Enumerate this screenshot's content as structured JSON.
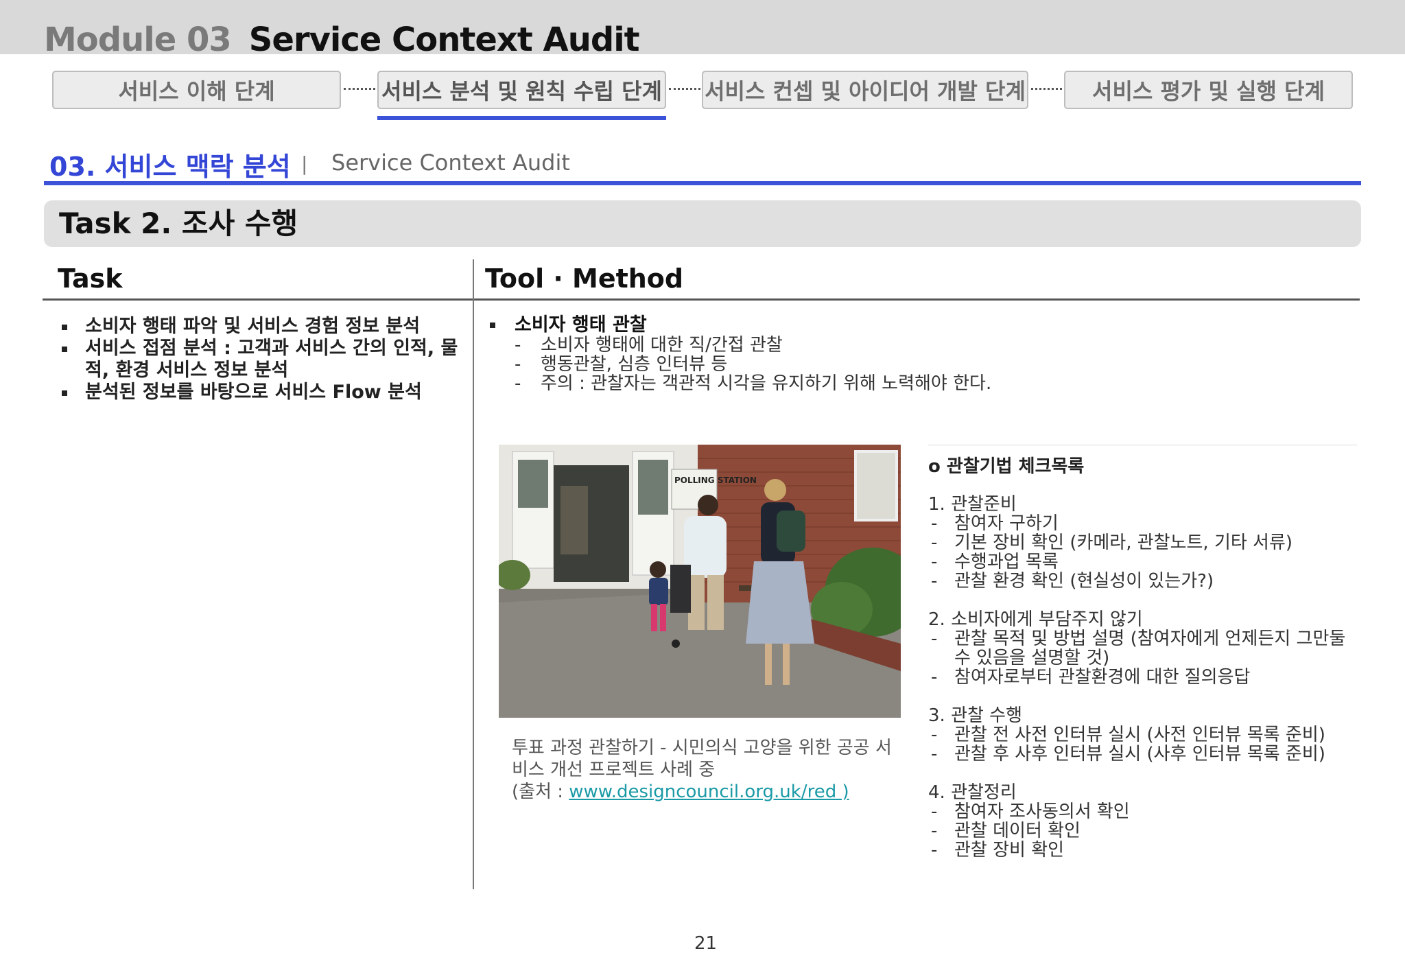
{
  "header": {
    "module_label": "Module 03",
    "module_name": "Service Context Audit"
  },
  "stages": [
    {
      "label": "서비스 이해 단계",
      "active": false
    },
    {
      "label": "서비스 분석 및 원칙 수립 단계",
      "active": true
    },
    {
      "label": "서비스 컨셉 및 아이디어 개발 단계",
      "active": false
    },
    {
      "label": "서비스 평가 및 실행 단계",
      "active": false
    }
  ],
  "section": {
    "title": "03. 서비스 맥락 분석",
    "separator": "|",
    "subtitle": "Service Context Audit"
  },
  "task_banner": "Task 2. 조사 수행",
  "columns": {
    "task": "Task",
    "method": "Tool · Method"
  },
  "tasks": [
    "소비자 행태 파악 및 서비스 경험 정보 분석",
    "서비스 접점 분석 : 고객과 서비스 간의 인적, 물적, 환경 서비스 정보 분석",
    "분석된 정보를 바탕으로 서비스 Flow 분석"
  ],
  "method": {
    "title": "소비자 행태 관찰",
    "items": [
      "소비자 행태에 대한 직/간접 관찰",
      "행동관찰, 심층 인터뷰 등",
      "주의 : 관찰자는 객관적 시각을 유지하기 위해 노력해야 한다."
    ]
  },
  "photo": {
    "sign_text": "POLLING STATION"
  },
  "caption": {
    "text": "투표 과정 관찰하기 - 시민의식 고양을 위한 공공 서비스 개선 프로젝트 사례 중",
    "source_prefix": "(출처 : ",
    "source_link": "www.designcouncil.org.uk/red )"
  },
  "checklist": {
    "title": "o 관찰기법 체크목록",
    "sections": [
      {
        "heading": "1. 관찰준비",
        "items": [
          "참여자 구하기",
          "기본 장비 확인 (카메라, 관찰노트, 기타 서류)",
          "수행과업 목록",
          "관찰 환경 확인 (현실성이 있는가?)"
        ]
      },
      {
        "heading": "2. 소비자에게 부담주지 않기",
        "items": [
          "관찰 목적 및 방법 설명 (참여자에게 언제든지 그만둘 수 있음을 설명할 것)",
          "참여자로부터 관찰환경에 대한 질의응답"
        ]
      },
      {
        "heading": "3. 관찰 수행",
        "items": [
          "관찰 전 사전 인터뷰 실시 (사전 인터뷰 목록 준비)",
          "관찰 후 사후 인터뷰 실시 (사후 인터뷰 목록 준비)"
        ]
      },
      {
        "heading": "4. 관찰정리",
        "items": [
          "참여자 조사동의서 확인",
          "관찰 데이터 확인",
          "관찰 장비 확인"
        ]
      }
    ]
  },
  "page_number": "21",
  "colors": {
    "accent": "#3b52d9",
    "section_title": "#3346d6",
    "link": "#1a9aa6",
    "band": "#d9d9d9"
  }
}
